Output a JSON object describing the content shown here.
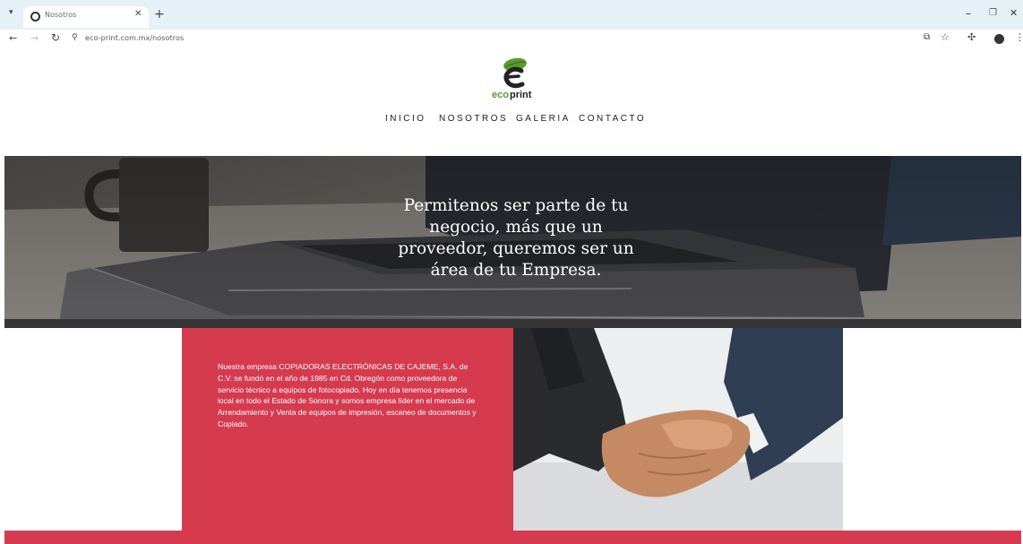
{
  "browser": {
    "tab_title": "Nosotros",
    "url": "eco-print.com.mx/nosotros",
    "icons": [
      "tab-menu-icon",
      "favicon-icon",
      "close-icon",
      "plus-icon",
      "minimize-icon",
      "maximize-icon",
      "close-window-icon",
      "back-icon",
      "forward-icon",
      "reload-icon",
      "site-info-icon",
      "extension-icon",
      "star-icon",
      "puzzle-icon",
      "profile-icon",
      "kebab-menu-icon"
    ]
  },
  "site": {
    "logo_text": {
      "eco": "eco",
      "print": "print"
    },
    "nav": [
      "INICIO",
      "NOSOTROS",
      "GALERIA",
      "CONTACTO"
    ],
    "hero_text": "Permitenos ser parte de tu negocio, más que un proveedor, queremos ser un área de tu Empresa.",
    "about_text": "Nuestra empresa COPIADORAS ELECTRÓNICAS DE CAJEME, S.A. de C.V. se fundó en el año de 1985 en Cd. Obregón como proveedora de servicio técnico a equipos de fotocopiado. Hoy en día tenemos presencia local en todo el Estado de Sonora y somos empresa líder en el mercado de Arrendamiento y Venta de equipos de impresión, escaneo de documentos y Copiado."
  },
  "colors": {
    "accent_red": "#d63a4f",
    "logo_green": "#5a9a2e",
    "logo_dark": "#222222",
    "tab_bar": "#e6f1f7"
  }
}
